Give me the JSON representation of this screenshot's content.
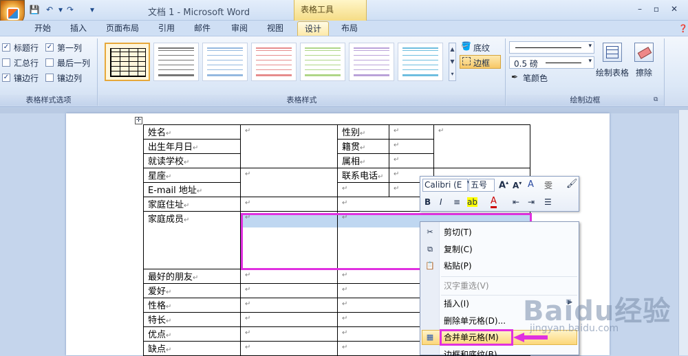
{
  "titlebar": {
    "doc_title": "文档 1 - Microsoft Word",
    "tool_tab_title": "表格工具",
    "qat": [
      "save-icon",
      "undo-icon",
      "redo-icon",
      "customize-icon"
    ]
  },
  "tabs": [
    "开始",
    "插入",
    "页面布局",
    "引用",
    "邮件",
    "审阅",
    "视图",
    "设计",
    "布局"
  ],
  "ribbon": {
    "table_style_options": {
      "label": "表格样式选项",
      "checkboxes": [
        {
          "label": "标题行",
          "checked": true
        },
        {
          "label": "第一列",
          "checked": true
        },
        {
          "label": "汇总行",
          "checked": false
        },
        {
          "label": "最后一列",
          "checked": false
        },
        {
          "label": "镶边行",
          "checked": true
        },
        {
          "label": "镶边列",
          "checked": false
        }
      ]
    },
    "table_styles": {
      "label": "表格样式",
      "shading": "底纹",
      "borders": "边框",
      "colors": [
        "#000000",
        "#555555",
        "#7aa7d8",
        "#e07070",
        "#9ccc6a",
        "#a98bd0",
        "#4aaed8"
      ]
    },
    "draw_borders": {
      "label": "绘制边框",
      "pen_weight": "0.5 磅",
      "pen_color": "笔颜色",
      "draw_table": "绘制表格",
      "eraser": "擦除"
    }
  },
  "table": {
    "rows": [
      {
        "c1": "姓名",
        "c3": "性别"
      },
      {
        "c1": "出生年月日",
        "c3": "籍贯"
      },
      {
        "c1": "就读学校",
        "c3": "属相"
      },
      {
        "c1": "星座",
        "c3": "联系电话"
      },
      {
        "c1": "E-mail 地址",
        "c3": ""
      },
      {
        "c1": "家庭住址",
        "c3": ""
      },
      {
        "c1": "家庭成员",
        "c3": ""
      },
      {
        "c1": "最好的朋友",
        "c3": ""
      },
      {
        "c1": "爱好",
        "c3": ""
      },
      {
        "c1": "性格",
        "c3": ""
      },
      {
        "c1": "特长",
        "c3": ""
      },
      {
        "c1": "优点",
        "c3": ""
      },
      {
        "c1": "缺点",
        "c3": ""
      }
    ],
    "para_mark": "↵"
  },
  "mini_toolbar": {
    "font": "Calibri (E",
    "size": "五号"
  },
  "context_menu": {
    "items": [
      "剪切(T)",
      "复制(C)",
      "粘贴(P)",
      "汉字重选(V)",
      "插入(I)",
      "删除单元格(D)...",
      "合并单元格(M)",
      "边框和底纹(B)..."
    ]
  },
  "watermark": {
    "brand": "Baidu经验",
    "url": "jingyan.baidu.com"
  }
}
